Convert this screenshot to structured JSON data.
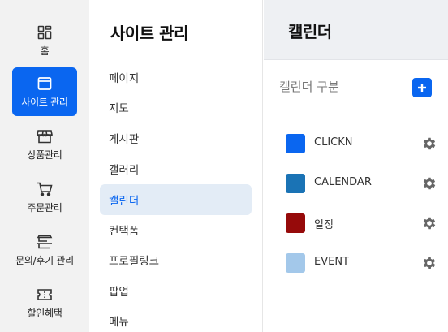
{
  "rail": {
    "items": [
      {
        "label": "홈",
        "icon": "grid-icon",
        "active": false
      },
      {
        "label": "사이트 관리",
        "icon": "browser-window-icon",
        "active": true
      },
      {
        "label": "상품관리",
        "icon": "store-icon",
        "active": false
      },
      {
        "label": "주문관리",
        "icon": "cart-icon",
        "active": false
      },
      {
        "label": "문의/후기 관리",
        "icon": "inquiry-icon",
        "active": false
      },
      {
        "label": "할인혜택",
        "icon": "coupon-icon",
        "active": false
      }
    ]
  },
  "submenu": {
    "title": "사이트 관리",
    "items": [
      {
        "label": "페이지",
        "active": false
      },
      {
        "label": "지도",
        "active": false
      },
      {
        "label": "게시판",
        "active": false
      },
      {
        "label": "갤러리",
        "active": false
      },
      {
        "label": "캘린더",
        "active": true
      },
      {
        "label": "컨택폼",
        "active": false
      },
      {
        "label": "프로필링크",
        "active": false
      },
      {
        "label": "팝업",
        "active": false
      },
      {
        "label": "메뉴",
        "active": false
      }
    ]
  },
  "content": {
    "title": "캘린더",
    "section_label": "캘린더 구분",
    "add_icon": "plus-icon",
    "calendars": [
      {
        "name": "CLICKN",
        "color": "#0a66f0",
        "settings_icon": "gear-icon"
      },
      {
        "name": "CALENDAR",
        "color": "#1a73b5",
        "settings_icon": "gear-icon"
      },
      {
        "name": "일정",
        "color": "#960a0a",
        "settings_icon": "gear-icon"
      },
      {
        "name": "EVENT",
        "color": "#a3c8ea",
        "settings_icon": "gear-icon"
      }
    ]
  },
  "colors": {
    "accent": "#0a66f0",
    "active_submenu_bg": "#e3ecf6",
    "rail_bg": "#f2f2f2",
    "header_bg": "#eef0f3"
  }
}
